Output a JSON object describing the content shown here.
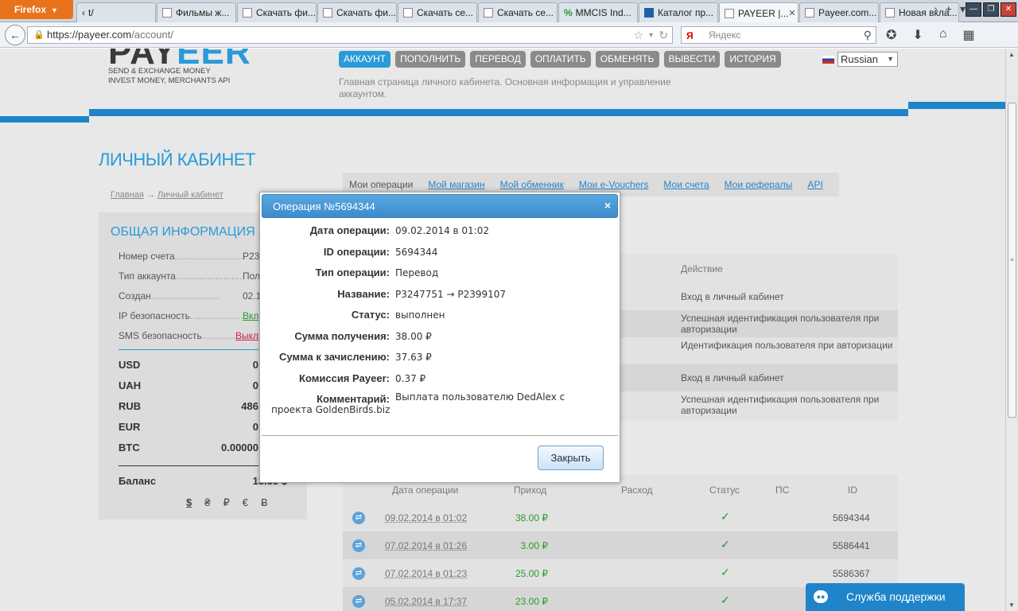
{
  "browser": {
    "menu_button": "Firefox",
    "tabs": [
      {
        "label": "t/"
      },
      {
        "label": "Фильмы ж..."
      },
      {
        "label": "Скачать фи..."
      },
      {
        "label": "Скачать фи..."
      },
      {
        "label": "Скачать се..."
      },
      {
        "label": "Скачать се..."
      },
      {
        "label": "MMCIS Ind..."
      },
      {
        "label": "Каталог пр..."
      },
      {
        "label": "PAYEER |..."
      },
      {
        "label": "Payeer.com..."
      },
      {
        "label": "Новая вкла..."
      }
    ],
    "url_host": "https://payeer.com",
    "url_path": "/account/",
    "search_placeholder": "Яндекс",
    "search_engine_badge": "Я"
  },
  "site": {
    "logo_left": "PAY",
    "logo_right": "EER",
    "slogan_line1": "SEND & EXCHANGE MONEY",
    "slogan_line2": "INVEST MONEY, MERCHANTS API",
    "menu": [
      "АККАУНТ",
      "ПОПОЛНИТЬ",
      "ПЕРЕВОД",
      "ОПЛАТИТЬ",
      "ОБМЕНЯТЬ",
      "ВЫВЕСТИ",
      "ИСТОРИЯ"
    ],
    "language": "Russian",
    "page_description": "Главная страница личного кабинета. Основная информация и управление аккаунтом.",
    "cabinet_title": "ЛИЧНЫЙ КАБИНЕТ",
    "breadcrumb_home": "Главная",
    "breadcrumb_arrow": "→",
    "breadcrumb_current": "Личный кабинет",
    "subtabs": [
      "Мои операции",
      "Мой магазин",
      "Мой обменник",
      "Мои e-Vouchers",
      "Мои счета",
      "Мои рефералы",
      "API"
    ]
  },
  "account_panel": {
    "title": "ОБЩАЯ ИНФОРМАЦИЯ АККАУНТА",
    "rows": [
      {
        "label": "Номер счета",
        "value": "P23"
      },
      {
        "label": "Тип аккаунта",
        "value": "Пользо"
      },
      {
        "label": "Создан",
        "value": "02.1"
      },
      {
        "label": "IP безопасность",
        "value": "Вкл"
      },
      {
        "label": "SMS безопасность",
        "value": "Выкл"
      }
    ],
    "currencies": [
      {
        "code": "USD",
        "value": "0"
      },
      {
        "code": "UAH",
        "value": "0"
      },
      {
        "code": "RUB",
        "value": "486"
      },
      {
        "code": "EUR",
        "value": "0"
      },
      {
        "code": "BTC",
        "value": "0.00000"
      }
    ],
    "balance_label": "Баланс",
    "balance_value": "13.33 $",
    "currency_icons": [
      "$",
      "₴",
      "₽",
      "€",
      "Ƀ"
    ]
  },
  "actions_table": {
    "header": "Действие",
    "rows": [
      "Вход в личный кабинет",
      "Успешная идентификация пользователя при авторизации",
      "Идентификация пользователя при авторизации",
      "Вход в личный кабинет",
      "Успешная идентификация пользователя при авторизации"
    ]
  },
  "operations_table": {
    "headers": {
      "date": "Дата операции",
      "income": "Приход",
      "expense": "Расход",
      "status": "Статус",
      "ps": "ПС",
      "id": "ID"
    },
    "rows": [
      {
        "date": "09.02.2014 в 01:02",
        "income": "38.00 ₽",
        "status": "✓",
        "id": "5694344"
      },
      {
        "date": "07.02.2014 в 01:26",
        "income": "3.00 ₽",
        "status": "✓",
        "id": "5586441"
      },
      {
        "date": "07.02.2014 в 01:23",
        "income": "25.00 ₽",
        "status": "✓",
        "id": "5586367"
      },
      {
        "date": "05.02.2014 в 17:37",
        "income": "23.00 ₽",
        "status": "✓",
        "id": ""
      }
    ]
  },
  "dialog": {
    "title": "Операция №5694344",
    "close": "×",
    "fields": [
      {
        "label": "Дата операции:",
        "value": "09.02.2014 в 01:02"
      },
      {
        "label": "ID операции:",
        "value": "5694344"
      },
      {
        "label": "Тип операции:",
        "value": "Перевод"
      },
      {
        "label": "Название:",
        "value": "P3247751 → P2399107"
      },
      {
        "label": "Статус:",
        "value": "выполнен"
      },
      {
        "label": "Сумма получения:",
        "value": "38.00 ₽"
      },
      {
        "label": "Сумма к зачислению:",
        "value": "37.63 ₽"
      },
      {
        "label": "Комиссия Payeer:",
        "value": "0.37 ₽"
      }
    ],
    "comment_label": "Комментарий:",
    "comment_value": "Выплата пользователю DedAlex с проекта GoldenBirds.biz",
    "button": "Закрыть"
  },
  "support": {
    "label": "Служба поддержки"
  },
  "colors": {
    "accent": "#2a9ad8",
    "stripe": "#1f84c9",
    "firefox": "#e8731a",
    "success": "#2a9a2a"
  }
}
